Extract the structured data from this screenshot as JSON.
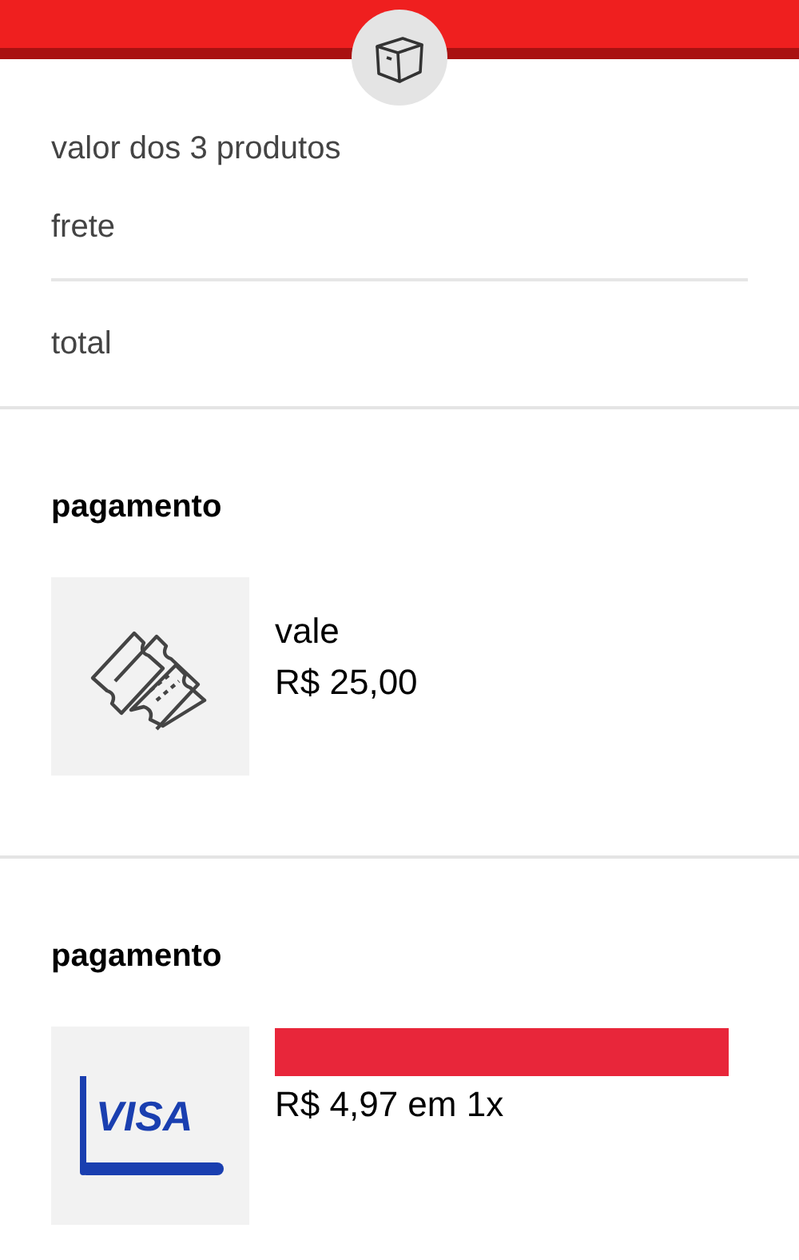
{
  "summary": {
    "lines": [
      {
        "label": "valor dos 3 produtos"
      },
      {
        "label": "frete"
      }
    ],
    "total": {
      "label": "total"
    }
  },
  "payments": [
    {
      "heading": "pagamento",
      "kind": "voucher",
      "name": "vale",
      "amount": "R$ 25,00"
    },
    {
      "heading": "pagamento",
      "kind": "card",
      "brand": "VISA",
      "redacted": true,
      "amount": "R$ 4,97 em 1x"
    }
  ]
}
